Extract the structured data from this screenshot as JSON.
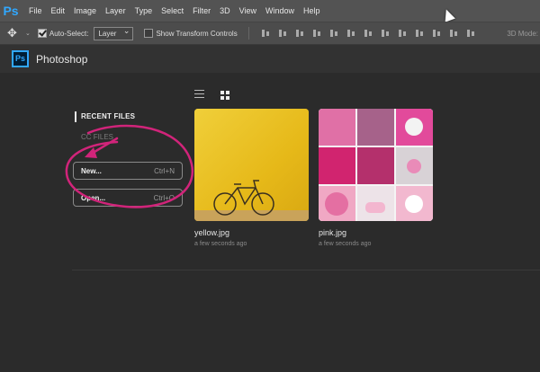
{
  "menubar": {
    "logo": "Ps",
    "items": [
      "File",
      "Edit",
      "Image",
      "Layer",
      "Type",
      "Select",
      "Filter",
      "3D",
      "View",
      "Window",
      "Help"
    ]
  },
  "options": {
    "auto_select_label": "Auto-Select:",
    "auto_select_checked": true,
    "layer_select_value": "Layer",
    "show_transform_label": "Show Transform Controls",
    "show_transform_checked": false,
    "mode_3d_label": "3D Mode:"
  },
  "titlebar": {
    "logo": "Ps",
    "title": "Photoshop"
  },
  "sidebar": {
    "recent_files": "RECENT FILES",
    "cc_files": "CC FILES",
    "new_button": {
      "label": "New...",
      "shortcut": "Ctrl+N"
    },
    "open_button": {
      "label": "Open...",
      "shortcut": "Ctrl+O"
    }
  },
  "recent": [
    {
      "name": "yellow.jpg",
      "time": "a few seconds ago"
    },
    {
      "name": "pink.jpg",
      "time": "a few seconds ago"
    }
  ],
  "colors": {
    "accent": "#31a8ff",
    "annotation": "#d1247a",
    "yellow": "#e9bf1d"
  }
}
